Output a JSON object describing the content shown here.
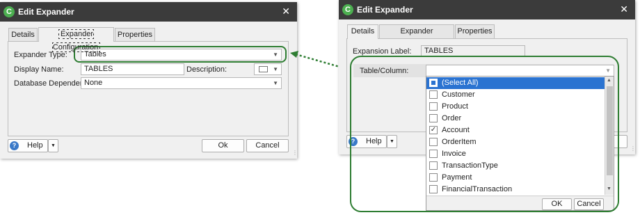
{
  "left_dialog": {
    "title": "Edit Expander",
    "close_glyph": "✕",
    "tabs": [
      "Details",
      "Expander Configuration",
      "Properties"
    ],
    "fields": {
      "expander_type_label": "Expander Type:",
      "expander_type_value": "Tables",
      "display_name_label": "Display Name:",
      "display_name_value": "TABLES",
      "description_label": "Description:",
      "database_dependent_label": "Database Dependent:",
      "database_dependent_value": "None"
    },
    "buttons": {
      "help": "Help",
      "ok": "Ok",
      "cancel": "Cancel"
    }
  },
  "right_dialog": {
    "title": "Edit Expander",
    "close_glyph": "✕",
    "tabs": [
      "Details",
      "Expander Configuration",
      "Properties"
    ],
    "fields": {
      "expansion_label_label": "Expansion Label:",
      "expansion_label_value": "TABLES",
      "table_column_label": "Table/Column:"
    },
    "buttons": {
      "help": "Help"
    },
    "dropdown": {
      "items": [
        {
          "label": "(Select All)",
          "checked": "partial",
          "selected": true
        },
        {
          "label": "Customer",
          "checked": false
        },
        {
          "label": "Product",
          "checked": false
        },
        {
          "label": "Order",
          "checked": false
        },
        {
          "label": "Account",
          "checked": true
        },
        {
          "label": "OrderItem",
          "checked": false
        },
        {
          "label": "Invoice",
          "checked": false
        },
        {
          "label": "TransactionType",
          "checked": false
        },
        {
          "label": "Payment",
          "checked": false
        },
        {
          "label": "FinancialTransaction",
          "checked": false
        }
      ],
      "ok": "OK",
      "cancel": "Cancel"
    }
  },
  "glyphs": {
    "dropdown_arrow": "▼",
    "check": "✓",
    "scroll_up": "▲",
    "scroll_down": "▼",
    "logo": "C",
    "help": "?"
  },
  "colors": {
    "annotation": "#2e7d32",
    "selection": "#2a73d1",
    "titlebar": "#3b3b3b"
  }
}
